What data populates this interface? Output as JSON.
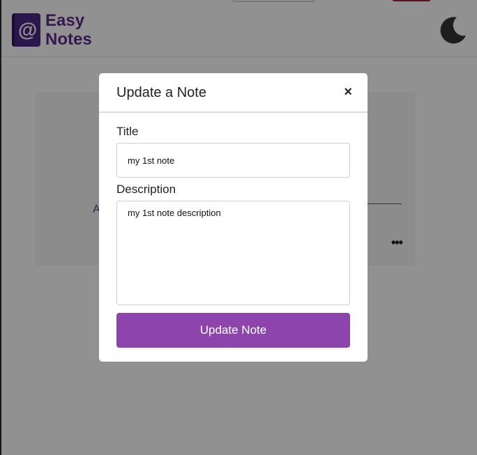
{
  "brand": {
    "logo_glyph": "@",
    "line1": "Easy",
    "line2": "Notes",
    "color": "#5f2a8c"
  },
  "theme_toggle": {
    "icon": "moon-icon"
  },
  "background_note": {
    "letter": "A",
    "menu_glyph": "•••"
  },
  "modal": {
    "title": "Update a Note",
    "close_glyph": "×",
    "title_label": "Title",
    "title_value": "my 1st note",
    "description_label": "Description",
    "description_value": "my 1st note description",
    "submit_label": "Update Note",
    "accent_color": "#8e44ad"
  }
}
